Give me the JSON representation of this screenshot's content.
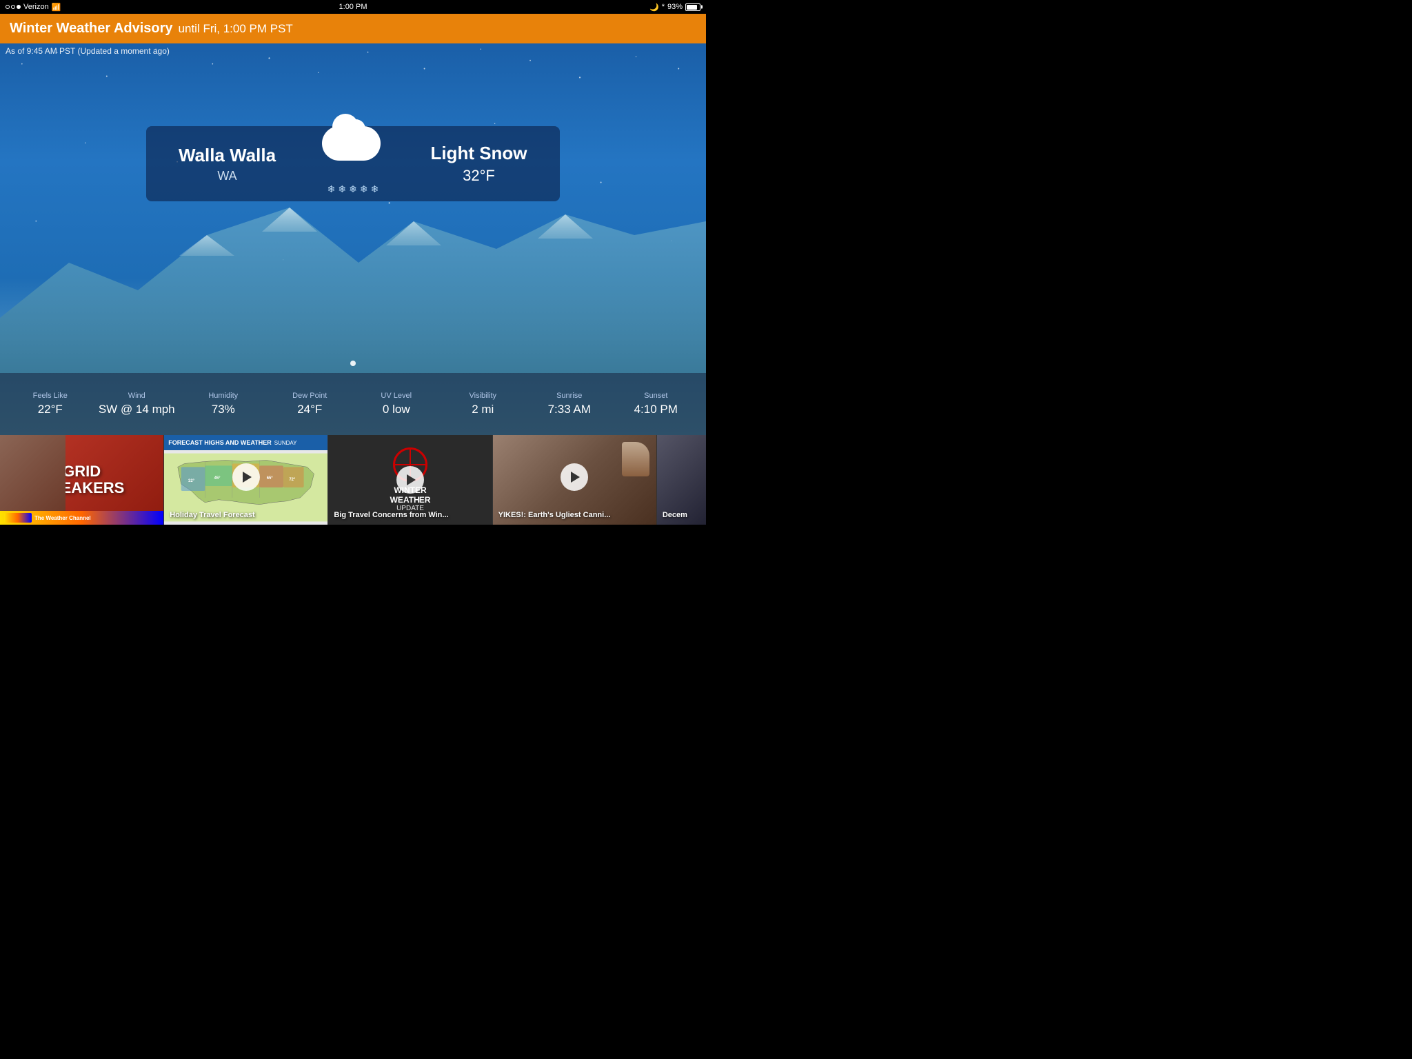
{
  "statusBar": {
    "carrier": "Verizon",
    "time": "1:00 PM",
    "battery": "93%",
    "batteryWidth": "85%"
  },
  "advisory": {
    "title": "Winter Weather Advisory",
    "subtitle": "until Fri, 1:00 PM PST"
  },
  "weather": {
    "timestamp": "As of 9:45 AM PST (Updated a moment ago)",
    "city": "Walla Walla",
    "state": "WA",
    "condition": "Light Snow",
    "temperature": "32°F",
    "stats": {
      "feelsLikeLabel": "Feels Like",
      "feelsLikeValue": "22°F",
      "windLabel": "Wind",
      "windValue": "SW @ 14 mph",
      "humidityLabel": "Humidity",
      "humidityValue": "73%",
      "dewPointLabel": "Dew Point",
      "dewPointValue": "24°F",
      "uvLabel": "UV Level",
      "uvValue": "0 low",
      "visibilityLabel": "Visibility",
      "visibilityValue": "2 mi",
      "sunriseLabel": "Sunrise",
      "sunriseValue": "7:33 AM",
      "sunsetLabel": "Sunset",
      "sunsetValue": "4:10 PM"
    }
  },
  "videoStrip": {
    "cards": [
      {
        "id": "grid-breakers",
        "title": "GRID BREAKERS",
        "hasPlay": false,
        "type": "grid-breakers"
      },
      {
        "id": "holiday-travel",
        "title": "Holiday Travel Forecast",
        "hasPlay": true,
        "mapTitle": "FORECAST HIGHS AND WEATHER",
        "mapDay": "SUNDAY",
        "type": "travel-map"
      },
      {
        "id": "big-travel",
        "title": "Big Travel Concerns from Win...",
        "hasPlay": true,
        "type": "winter-update"
      },
      {
        "id": "yikes",
        "title": "YIKES!: Earth's Ugliest Canni...",
        "hasPlay": true,
        "type": "yikes"
      },
      {
        "id": "decem",
        "title": "Decem",
        "hasPlay": false,
        "type": "decem"
      }
    ]
  }
}
